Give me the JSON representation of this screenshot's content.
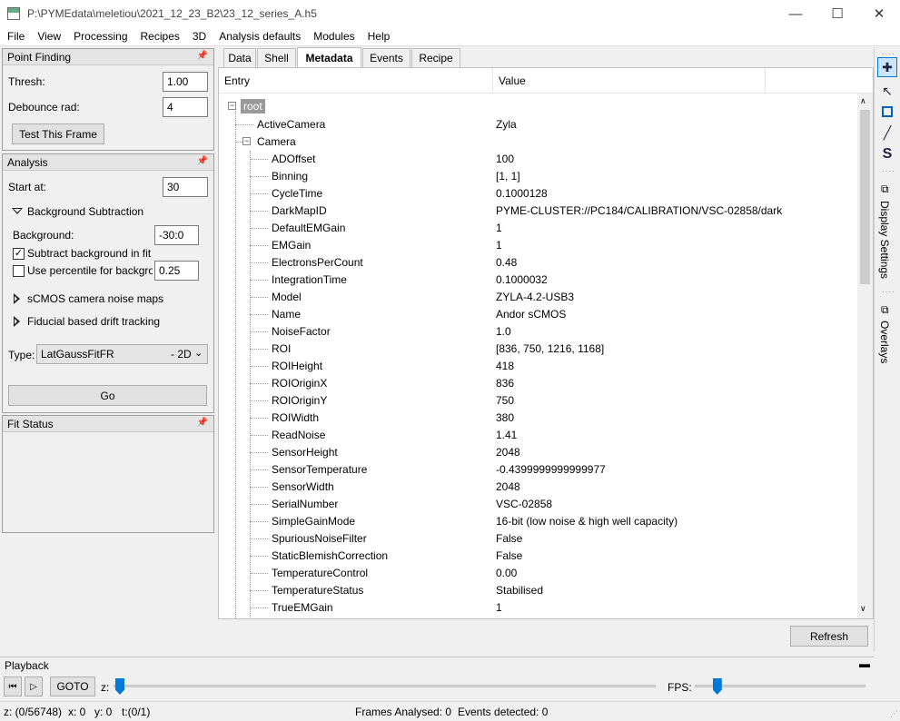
{
  "window": {
    "title": "P:\\PYMEdata\\meletiou\\2021_12_23_B2\\23_12_series_A.h5",
    "minimize": "—",
    "maximize": "☐",
    "close": "✕"
  },
  "menu": [
    "File",
    "View",
    "Processing",
    "Recipes",
    "3D",
    "Analysis defaults",
    "Modules",
    "Help"
  ],
  "point_finding": {
    "header": "Point Finding",
    "thresh_label": "Thresh:",
    "thresh_value": "1.00",
    "debounce_label": "Debounce rad:",
    "debounce_value": "4",
    "test_button": "Test This Frame"
  },
  "analysis": {
    "header": "Analysis",
    "start_label": "Start at:",
    "start_value": "30",
    "bg_section": "Background Subtraction",
    "background_label": "Background:",
    "background_value": "-30:0",
    "subtract_label": "Subtract background in fit",
    "subtract_checked": true,
    "percentile_label": "Use percentile for backgrou",
    "percentile_checked": false,
    "percentile_value": "0.25",
    "scmos_section": "sCMOS camera noise maps",
    "fiducial_section": "Fiducial based drift tracking",
    "type_label": "Type:",
    "type_value": "LatGaussFitFR",
    "type_suffix": "- 2D",
    "go_button": "Go"
  },
  "fit_status": {
    "header": "Fit Status"
  },
  "tabs": [
    {
      "label": "Data",
      "active": false
    },
    {
      "label": "Shell",
      "active": false
    },
    {
      "label": "Metadata",
      "active": true
    },
    {
      "label": "Events",
      "active": false
    },
    {
      "label": "Recipe",
      "active": false
    }
  ],
  "tree": {
    "col_entry": "Entry",
    "col_value": "Value",
    "root": "root",
    "rows": [
      {
        "key": "ActiveCamera",
        "value": "Zyla",
        "level": 1
      },
      {
        "key": "Camera",
        "value": "",
        "level": 1,
        "expander": true
      },
      {
        "key": "ADOffset",
        "value": "100",
        "level": 2
      },
      {
        "key": "Binning",
        "value": "[1, 1]",
        "level": 2
      },
      {
        "key": "CycleTime",
        "value": "0.1000128",
        "level": 2
      },
      {
        "key": "DarkMapID",
        "value": "PYME-CLUSTER://PC184/CALIBRATION/VSC-02858/dark",
        "level": 2
      },
      {
        "key": "DefaultEMGain",
        "value": "1",
        "level": 2
      },
      {
        "key": "EMGain",
        "value": "1",
        "level": 2
      },
      {
        "key": "ElectronsPerCount",
        "value": "0.48",
        "level": 2
      },
      {
        "key": "IntegrationTime",
        "value": "0.1000032",
        "level": 2
      },
      {
        "key": "Model",
        "value": "ZYLA-4.2-USB3",
        "level": 2
      },
      {
        "key": "Name",
        "value": "Andor sCMOS",
        "level": 2
      },
      {
        "key": "NoiseFactor",
        "value": "1.0",
        "level": 2
      },
      {
        "key": "ROI",
        "value": "[836, 750, 1216, 1168]",
        "level": 2
      },
      {
        "key": "ROIHeight",
        "value": "418",
        "level": 2
      },
      {
        "key": "ROIOriginX",
        "value": "836",
        "level": 2
      },
      {
        "key": "ROIOriginY",
        "value": "750",
        "level": 2
      },
      {
        "key": "ROIWidth",
        "value": "380",
        "level": 2
      },
      {
        "key": "ReadNoise",
        "value": "1.41",
        "level": 2
      },
      {
        "key": "SensorHeight",
        "value": "2048",
        "level": 2
      },
      {
        "key": "SensorTemperature",
        "value": "-0.4399999999999977",
        "level": 2
      },
      {
        "key": "SensorWidth",
        "value": "2048",
        "level": 2
      },
      {
        "key": "SerialNumber",
        "value": "VSC-02858",
        "level": 2
      },
      {
        "key": "SimpleGainMode",
        "value": "16-bit (low noise & high well capacity)",
        "level": 2
      },
      {
        "key": "SpuriousNoiseFilter",
        "value": "False",
        "level": 2
      },
      {
        "key": "StaticBlemishCorrection",
        "value": "False",
        "level": 2
      },
      {
        "key": "TemperatureControl",
        "value": "0.00",
        "level": 2
      },
      {
        "key": "TemperatureStatus",
        "value": "Stabilised",
        "level": 2
      },
      {
        "key": "TrueEMGain",
        "value": "1",
        "level": 2
      }
    ]
  },
  "refresh_button": "Refresh",
  "side_tabs": {
    "display_settings": "Display Settings",
    "overlays": "Overlays"
  },
  "playback": {
    "header": "Playback",
    "goto_button": "GOTO",
    "z_label": "z:",
    "fps_label": "FPS:",
    "z_fraction": 0.0,
    "fps_fraction": 0.1
  },
  "status": {
    "z": "z: (0/56748)",
    "x": "x: 0",
    "y": "y: 0",
    "t": "t:(0/1)",
    "frames": "Frames Analysed: 0",
    "events": "Events detected: 0"
  },
  "colors": {
    "accent": "#0078d7",
    "root_highlight": "#9a9a9a"
  }
}
